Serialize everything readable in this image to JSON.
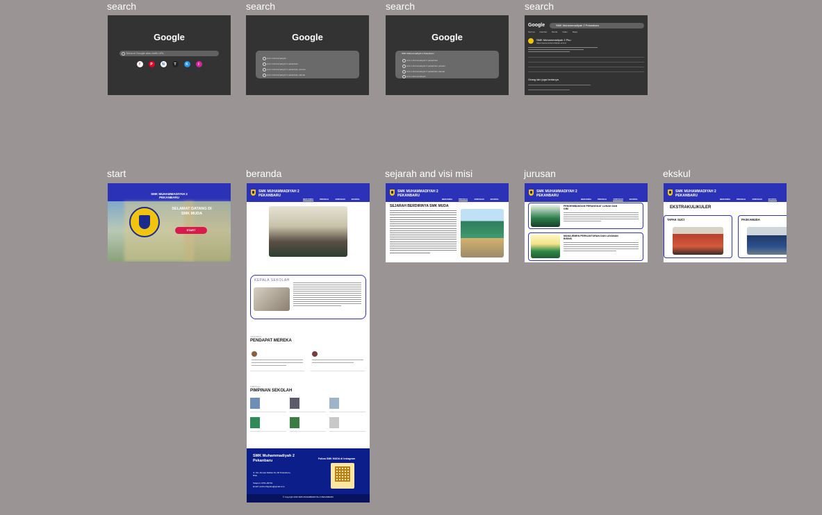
{
  "frame_labels": {
    "search1": "search",
    "search2": "search",
    "search3": "search",
    "search4": "search",
    "start": "start",
    "beranda": "beranda",
    "sejarah": "sejarah and visi misi",
    "jurusan": "jurusan",
    "ekskul": "ekskul"
  },
  "google": {
    "logo": "Google",
    "placeholder": "Telusuri Google atau ketik URL",
    "query": "SMK Muhammadiyah 2 Pekanbaru",
    "suggestions": [
      "smk muhammadiyah",
      "smk muhammadiyah 2 pekanbaru",
      "smk muhammadiyah 2 pekanbaru jurusan",
      "smk muhammadiyah 2 pekanbaru alamat"
    ],
    "result_title": "SMK Muhammadiyah 2 Pku",
    "result_url": "https://www.smkmuh2pku.sch.id",
    "result_section": "Orang lain juga bertanya",
    "tabs": [
      "Semua",
      "Gambar",
      "Berita",
      "Video",
      "Maps"
    ],
    "apps": [
      "f",
      "P",
      "N",
      "T",
      "K",
      "I"
    ]
  },
  "site": {
    "name_line1": "SMK MUHAMMADIYAH 2",
    "name_line2": "PEKANBARU",
    "nav": [
      "BERANDA",
      "PROFILE",
      "JURUSAN",
      "EKSKUL"
    ],
    "welcome_line1": "SELAMAT DATANG DI",
    "welcome_line2": "SMK MUDA",
    "start_button": "START",
    "kepsek_title": "KEPALA SEKOLAH",
    "testimoni_kicker": "TESTIMONI",
    "testimoni_title": "PENDAPAT MEREKA",
    "pimpinan_kicker": "PIMPINAN",
    "pimpinan_title": "PIMPINAN SEKOLAH",
    "footer_name_line1": "SMK Muhammadiyah 2",
    "footer_name_line2": "Pekanbaru",
    "footer_follow": "Follow SMK MUDA di Instagram",
    "footer_address": "Jl. KH. Ahmad Dahlan No.90 Pekanbaru, Riau",
    "footer_phone": "Telepon: 0761-36719",
    "footer_email": "Email: smkmuhapeku@gmail.com",
    "footer_copy": "© Copyright 2024 SMK MUHAMMADIYAH 2 PEKANBARU",
    "sejarah_title": "SEJARAH BERDIRINYA SMK MUDA",
    "jurusan1": "PENGEMBANGAN PERANGKAT LUNAK DAN GIM",
    "jurusan2": "MANAJEMEN PERKANTORAN DAN LAYANAN BISNIS",
    "ekskul_title": "EKSTRAKULIKULER",
    "ekskul1": "TAPAK SUCI",
    "ekskul2": "PASKAMUDA"
  },
  "colors": {
    "canvas": "#9a9494",
    "google_bg": "#333333",
    "site_blue": "#2b32b8",
    "footer_blue": "#0c1e8a",
    "start_button": "#d81b4c"
  }
}
